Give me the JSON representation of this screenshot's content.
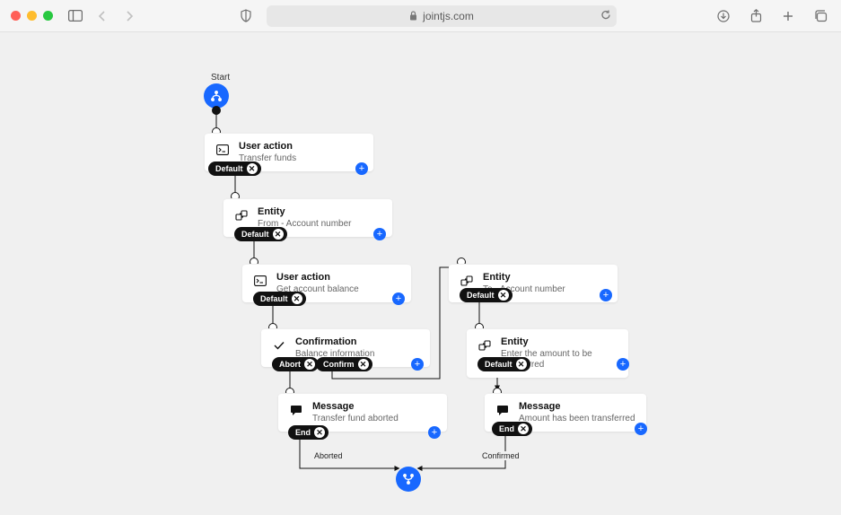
{
  "browser": {
    "url_host": "jointjs.com"
  },
  "diagram": {
    "start_label": "Start",
    "buttons": {
      "default": "Default",
      "abort": "Abort",
      "confirm": "Confirm",
      "end": "End"
    },
    "nodes": {
      "n1": {
        "title": "User action",
        "subtitle": "Transfer funds"
      },
      "n2": {
        "title": "Entity",
        "subtitle": "From - Account number"
      },
      "n3": {
        "title": "User action",
        "subtitle": "Get account balance"
      },
      "n4": {
        "title": "Confirmation",
        "subtitle": "Balance information"
      },
      "n5": {
        "title": "Message",
        "subtitle": "Transfer fund aborted"
      },
      "nR1": {
        "title": "Entity",
        "subtitle": "To - Account number"
      },
      "nR2": {
        "title": "Entity",
        "subtitle": "Enter the amount to be transferred"
      },
      "nR3": {
        "title": "Message",
        "subtitle": "Amount has been transferred"
      }
    },
    "link_labels": {
      "aborted": "Aborted",
      "confirmed": "Confirmed"
    }
  }
}
